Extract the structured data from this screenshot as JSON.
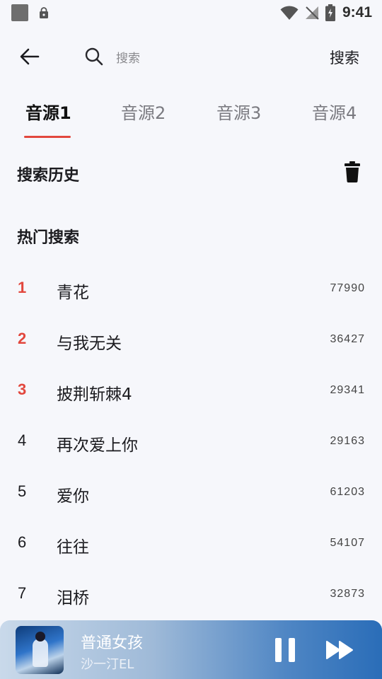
{
  "status_bar": {
    "time": "9:41"
  },
  "top_bar": {
    "search_placeholder": "搜索",
    "search_action": "搜索"
  },
  "tabs": [
    {
      "label": "音源1",
      "active": true
    },
    {
      "label": "音源2",
      "active": false
    },
    {
      "label": "音源3",
      "active": false
    },
    {
      "label": "音源4",
      "active": false
    }
  ],
  "history": {
    "title": "搜索历史"
  },
  "hot": {
    "title": "热门搜索",
    "items": [
      {
        "rank": "1",
        "name": "青花",
        "count": "77990"
      },
      {
        "rank": "2",
        "name": "与我无关",
        "count": "36427"
      },
      {
        "rank": "3",
        "name": "披荆斩棘4",
        "count": "29341"
      },
      {
        "rank": "4",
        "name": "再次爱上你",
        "count": "29163"
      },
      {
        "rank": "5",
        "name": "爱你",
        "count": "61203"
      },
      {
        "rank": "6",
        "name": "往往",
        "count": "54107"
      },
      {
        "rank": "7",
        "name": "泪桥",
        "count": "32873"
      }
    ]
  },
  "player": {
    "title": "普通女孩",
    "artist": "沙一汀EL"
  },
  "colors": {
    "accent": "#e2473d",
    "background": "#f6f7fb"
  }
}
